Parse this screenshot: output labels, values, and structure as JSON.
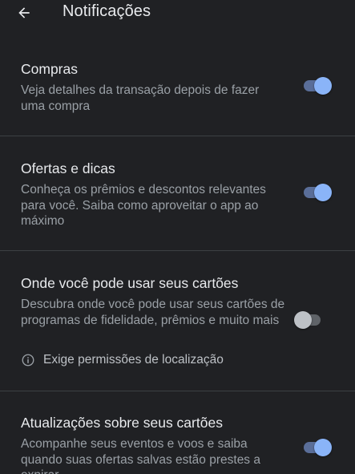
{
  "header": {
    "title": "Notificações",
    "back_icon": "arrow-back-icon"
  },
  "colors": {
    "background": "#202124",
    "divider": "#3c4043",
    "toggle_on": "#8ab4f8",
    "toggle_off": "#bdc1c6",
    "text_primary": "#e8eaed",
    "text_secondary": "#9aa0a6"
  },
  "settings": [
    {
      "title": "Compras",
      "description": "Veja detalhes da transação depois de fazer uma compra",
      "enabled": true
    },
    {
      "title": "Ofertas e dicas",
      "description": "Conheça os prêmios e descontos relevantes para você. Saiba como aproveitar o app ao máximo",
      "enabled": true
    },
    {
      "title": "Onde você pode usar seus cartões",
      "description": "Descubra onde você pode usar seus cartões de programas de fidelidade, prêmios e muito mais",
      "note": "Exige permissões de localização",
      "note_icon": "info-icon",
      "enabled": false
    },
    {
      "title": "Atualizações sobre seus cartões",
      "description": "Acompanhe seus eventos e voos e saiba quando suas ofertas salvas estão prestes a expirar",
      "enabled": true
    }
  ]
}
